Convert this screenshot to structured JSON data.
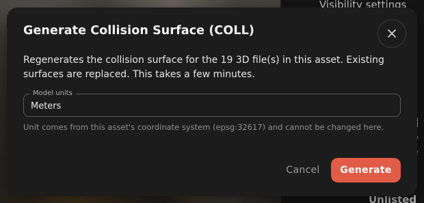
{
  "background": {
    "side_panel": {
      "visibility_label": "Visibility settings",
      "unlisted_label": "Unlisted",
      "fragments": [
        "s",
        "t",
        "d",
        "o",
        "e"
      ]
    }
  },
  "modal": {
    "title": "Generate Collision Surface (COLL)",
    "description": "Regenerates the collision surface for the 19 3D file(s) in this asset. Existing surfaces are replaced. This takes a few minutes.",
    "field": {
      "label": "Model units",
      "value": "Meters"
    },
    "helper_text": "Unit comes from this asset's coordinate system (epsg:32617) and cannot be changed here.",
    "actions": {
      "cancel_label": "Cancel",
      "generate_label": "Generate"
    },
    "icons": {
      "close": "close-icon"
    }
  },
  "colors": {
    "accent": "#e15b47",
    "modal_bg": "#1c1c1c",
    "panel_bg": "#141414"
  }
}
